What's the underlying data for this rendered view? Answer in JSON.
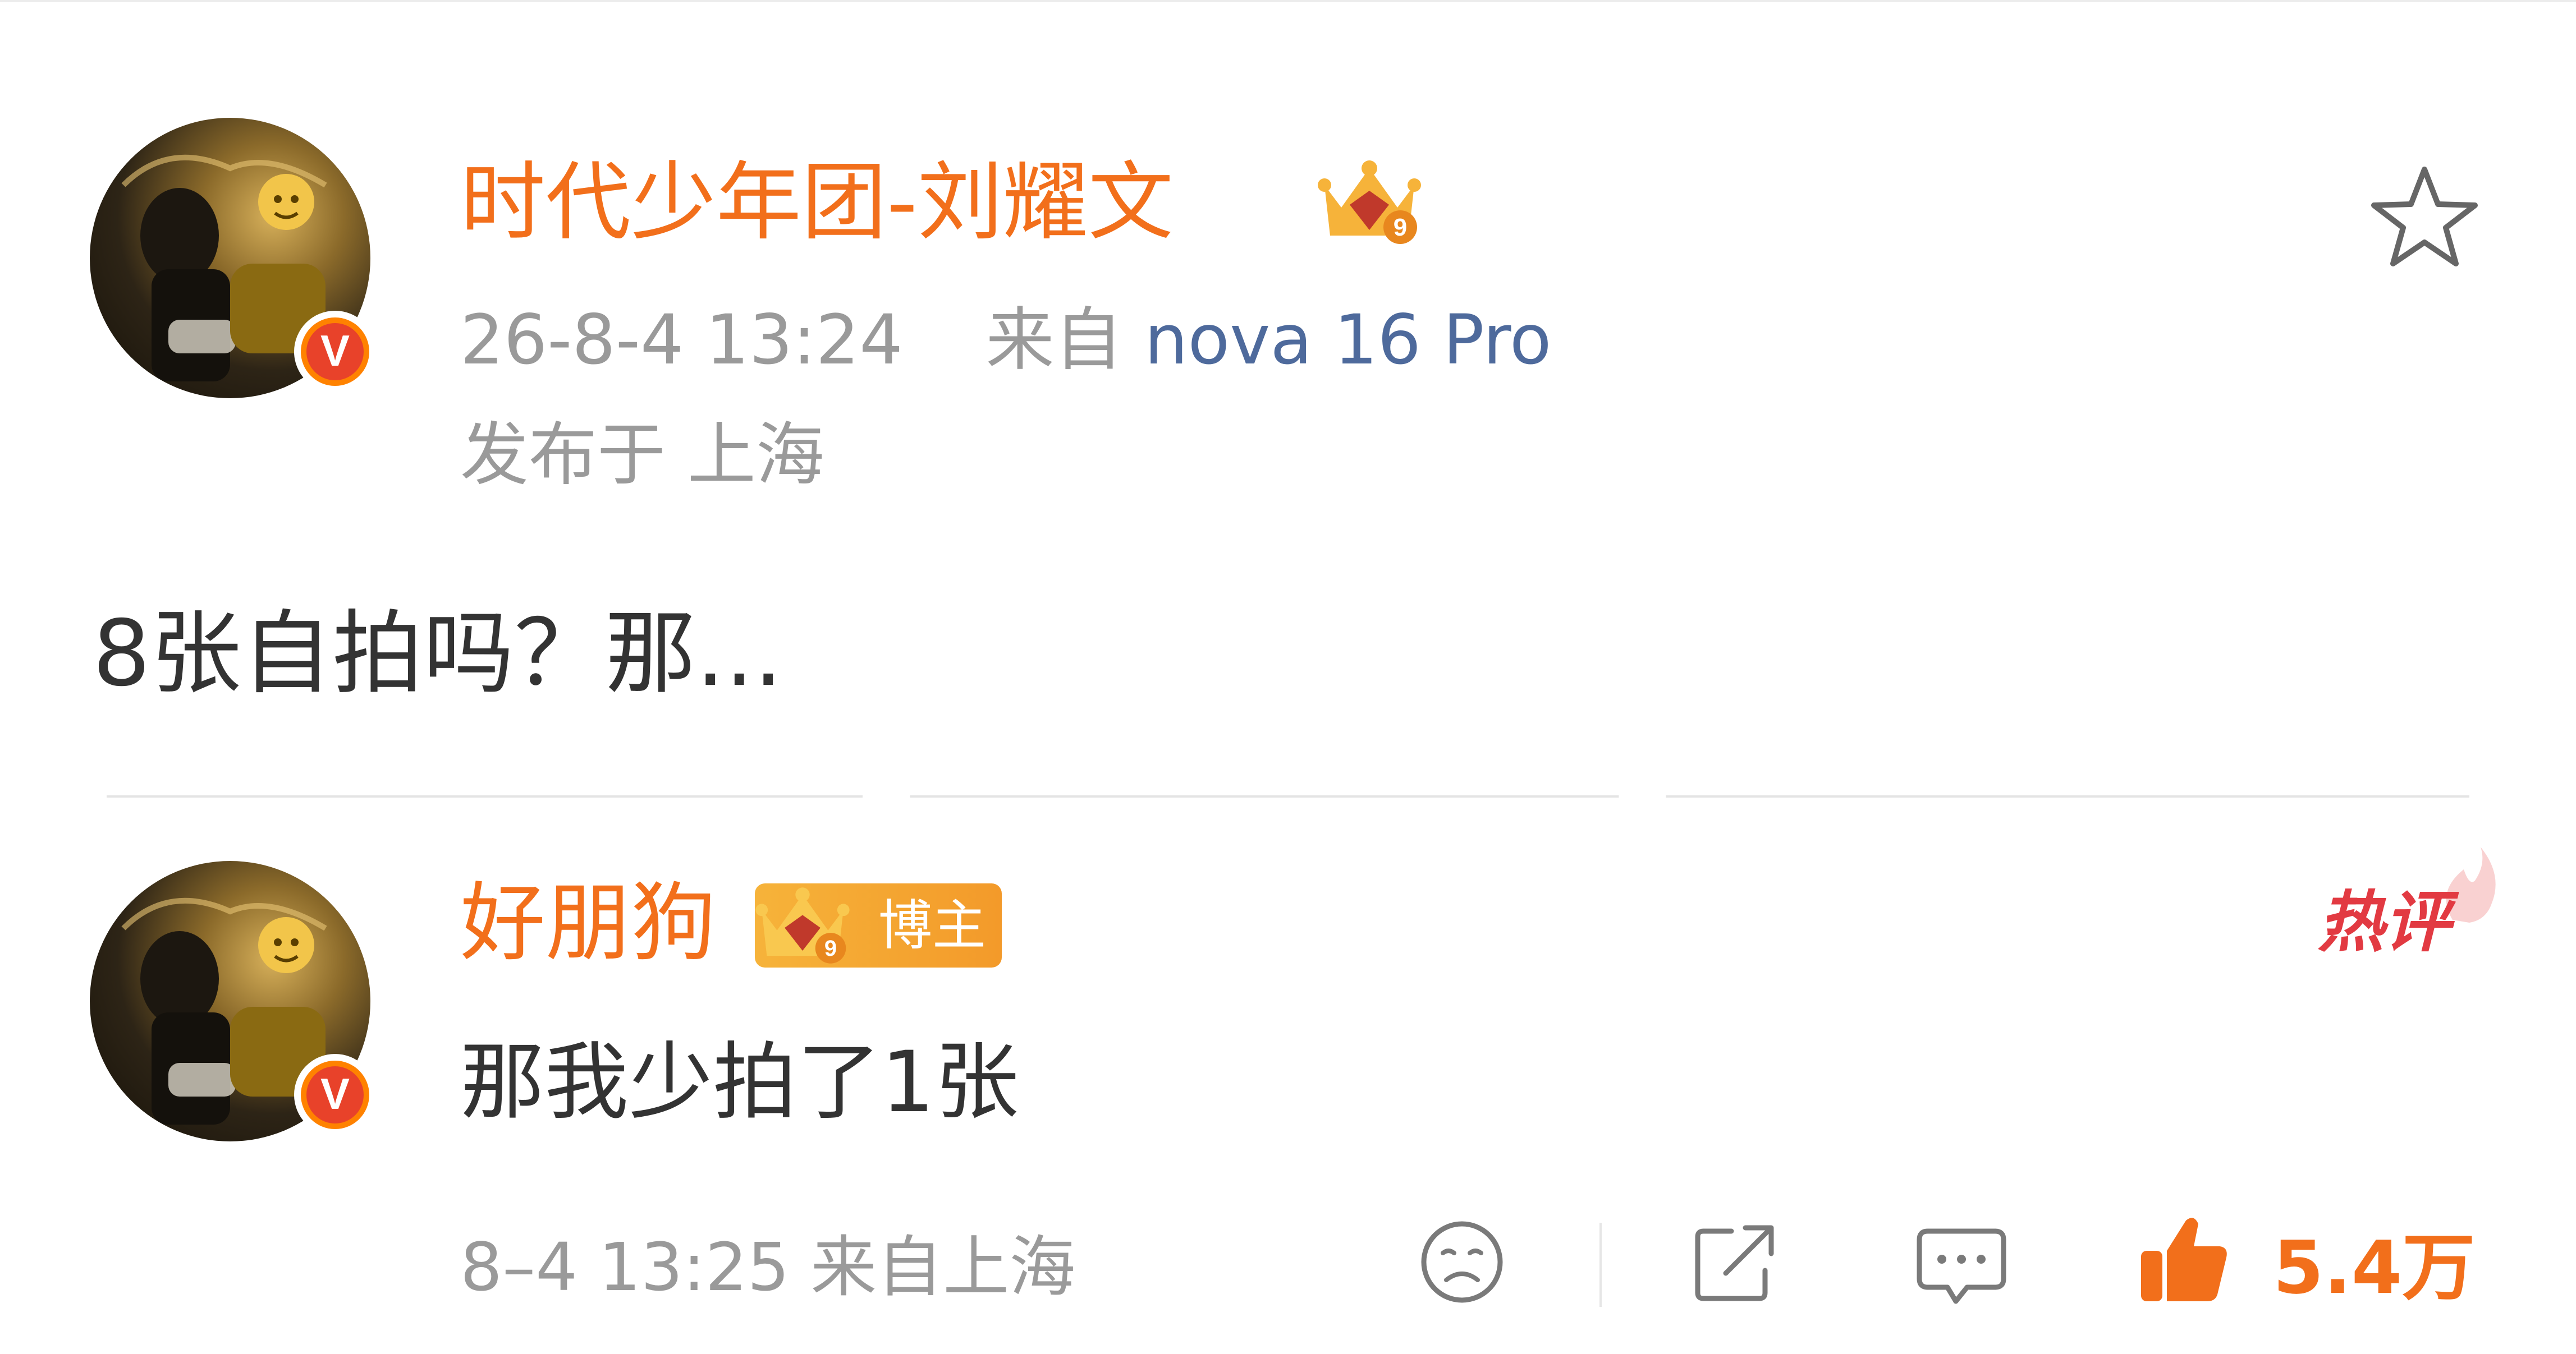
{
  "post": {
    "author": "时代少年团-刘耀文",
    "timestamp": "26-8-4 13:24",
    "source_prefix": "来自",
    "device": "nova 16 Pro",
    "location": "发布于 上海",
    "text": "8张自拍吗？那...",
    "level": "9"
  },
  "reply": {
    "author": "好朋狗",
    "blogger_label": "博主",
    "level": "9",
    "hot_label": "热评",
    "text": "那我少拍了1张",
    "meta": "8–4 13:25 来自上海",
    "like_count": "5.4万"
  },
  "icons": {
    "favorite": "star-icon",
    "react": "sad-face-icon",
    "share": "share-icon",
    "comment": "comment-icon",
    "like": "thumbs-up-icon",
    "verified": "v-badge-icon",
    "crown": "crown-level-icon"
  },
  "colors": {
    "accent": "#f26f1b",
    "device": "#4e6a9c",
    "hot": "#e23a42",
    "muted": "#9a9a9a"
  }
}
